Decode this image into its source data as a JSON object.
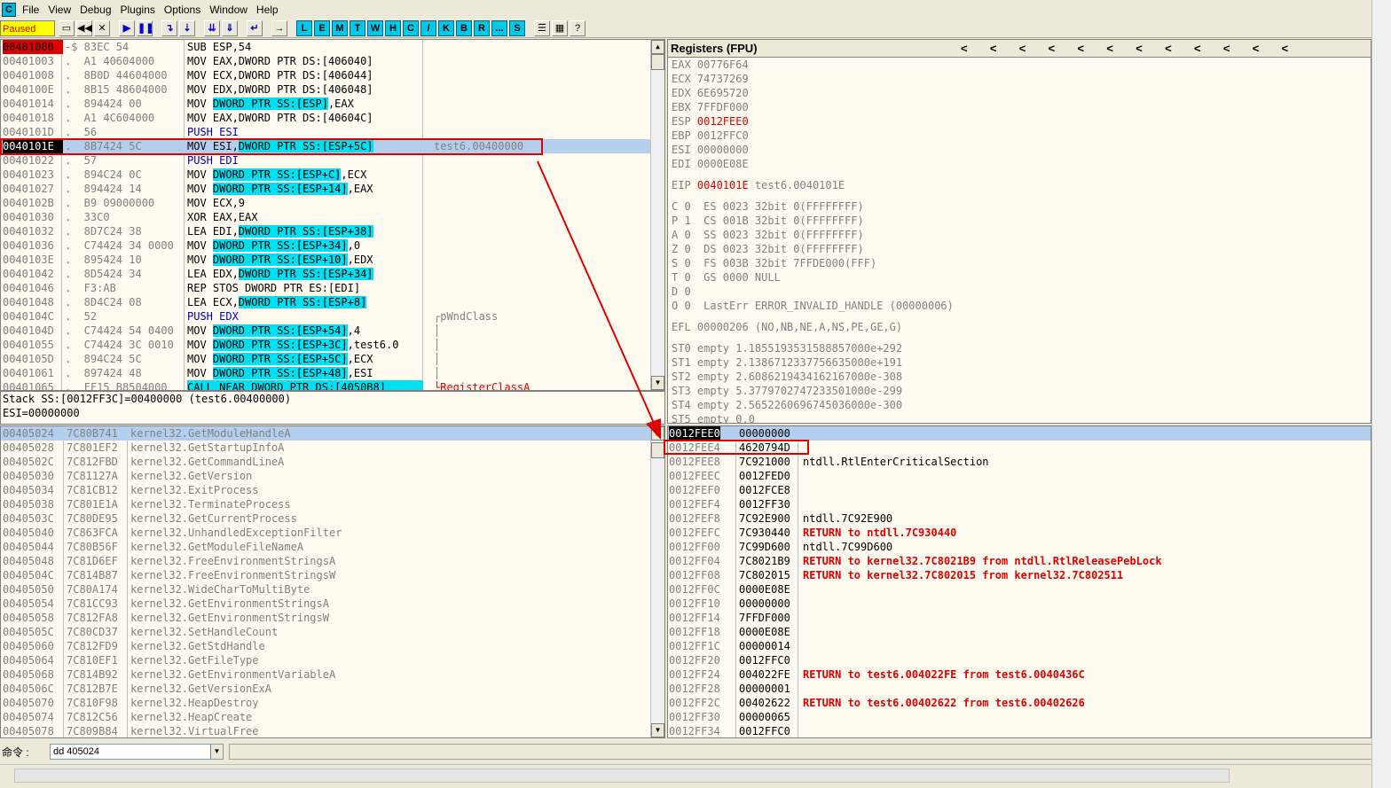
{
  "menu": [
    "File",
    "View",
    "Debug",
    "Plugins",
    "Options",
    "Window",
    "Help"
  ],
  "status": "Paused",
  "toolbar_letters": [
    "L",
    "E",
    "M",
    "T",
    "W",
    "H",
    "C",
    "/",
    "K",
    "B",
    "R",
    "...",
    "S"
  ],
  "cpu": [
    {
      "addr": "00401000",
      "mark": "-$",
      "hex": "83EC 54",
      "asm": "SUB ESP,54",
      "comment": ""
    },
    {
      "addr": "00401003",
      "mark": ".",
      "hex": "A1 40604000",
      "asm": "MOV EAX,DWORD PTR DS:[406040]",
      "comment": ""
    },
    {
      "addr": "00401008",
      "mark": ".",
      "hex": "8B0D 44604000",
      "asm": "MOV ECX,DWORD PTR DS:[406044]",
      "comment": ""
    },
    {
      "addr": "0040100E",
      "mark": ".",
      "hex": "8B15 48604000",
      "asm": "MOV EDX,DWORD PTR DS:[406048]",
      "comment": ""
    },
    {
      "addr": "00401014",
      "mark": ".",
      "hex": "894424 00",
      "asm": "MOV DWORD PTR SS:[ESP],EAX",
      "comment": ""
    },
    {
      "addr": "00401018",
      "mark": ".",
      "hex": "A1 4C604000",
      "asm": "MOV EAX,DWORD PTR DS:[40604C]",
      "comment": ""
    },
    {
      "addr": "0040101D",
      "mark": ".",
      "hex": "56",
      "asm": "PUSH ESI",
      "comment": ""
    },
    {
      "addr": "0040101E",
      "mark": ".",
      "hex": "8B7424 5C",
      "asm": "MOV ESI,DWORD PTR SS:[ESP+5C]",
      "comment": "test6.00400000"
    },
    {
      "addr": "00401022",
      "mark": ".",
      "hex": "57",
      "asm": "PUSH EDI",
      "comment": ""
    },
    {
      "addr": "00401023",
      "mark": ".",
      "hex": "894C24 0C",
      "asm": "MOV DWORD PTR SS:[ESP+C],ECX",
      "comment": ""
    },
    {
      "addr": "00401027",
      "mark": ".",
      "hex": "894424 14",
      "asm": "MOV DWORD PTR SS:[ESP+14],EAX",
      "comment": ""
    },
    {
      "addr": "0040102B",
      "mark": ".",
      "hex": "B9 09000000",
      "asm": "MOV ECX,9",
      "comment": ""
    },
    {
      "addr": "00401030",
      "mark": ".",
      "hex": "33C0",
      "asm": "XOR EAX,EAX",
      "comment": ""
    },
    {
      "addr": "00401032",
      "mark": ".",
      "hex": "8D7C24 38",
      "asm": "LEA EDI,DWORD PTR SS:[ESP+38]",
      "comment": ""
    },
    {
      "addr": "00401036",
      "mark": ".",
      "hex": "C74424 34 0000",
      "asm": "MOV DWORD PTR SS:[ESP+34],0",
      "comment": ""
    },
    {
      "addr": "0040103E",
      "mark": ".",
      "hex": "895424 10",
      "asm": "MOV DWORD PTR SS:[ESP+10],EDX",
      "comment": ""
    },
    {
      "addr": "00401042",
      "mark": ".",
      "hex": "8D5424 34",
      "asm": "LEA EDX,DWORD PTR SS:[ESP+34]",
      "comment": ""
    },
    {
      "addr": "00401046",
      "mark": ".",
      "hex": "F3:AB",
      "asm": "REP STOS DWORD PTR ES:[EDI]",
      "comment": ""
    },
    {
      "addr": "00401048",
      "mark": ".",
      "hex": "8D4C24 08",
      "asm": "LEA ECX,DWORD PTR SS:[ESP+8]",
      "comment": ""
    },
    {
      "addr": "0040104C",
      "mark": ".",
      "hex": "52",
      "asm": "PUSH EDX",
      "comment": "┌pWndClass"
    },
    {
      "addr": "0040104D",
      "mark": ".",
      "hex": "C74424 54 0400",
      "asm": "MOV DWORD PTR SS:[ESP+54],4",
      "comment": "│"
    },
    {
      "addr": "00401055",
      "mark": ".",
      "hex": "C74424 3C 0010",
      "asm": "MOV DWORD PTR SS:[ESP+3C],test6.0",
      "comment": "│"
    },
    {
      "addr": "0040105D",
      "mark": ".",
      "hex": "894C24 5C",
      "asm": "MOV DWORD PTR SS:[ESP+5C],ECX",
      "comment": "│"
    },
    {
      "addr": "00401061",
      "mark": ".",
      "hex": "897424 48",
      "asm": "MOV DWORD PTR SS:[ESP+48],ESI",
      "comment": "│"
    },
    {
      "addr": "00401065",
      "mark": ".",
      "hex": "FF15 B8504000",
      "asm": "CALL NEAR DWORD PTR DS:[4050B8]",
      "comment": "└RegisterClassA"
    }
  ],
  "info": [
    "Stack SS:[0012FF3C]=00400000 (test6.00400000)",
    "ESI=00000000"
  ],
  "registers_title": "Registers (FPU)",
  "regs": [
    {
      "name": "EAX",
      "val": "00776F64",
      "extra": ""
    },
    {
      "name": "ECX",
      "val": "74737269",
      "extra": ""
    },
    {
      "name": "EDX",
      "val": "6E695720",
      "extra": ""
    },
    {
      "name": "EBX",
      "val": "7FFDF000",
      "extra": ""
    },
    {
      "name": "ESP",
      "val": "0012FEE0",
      "extra": ""
    },
    {
      "name": "EBP",
      "val": "0012FFC0",
      "extra": ""
    },
    {
      "name": "ESI",
      "val": "00000000",
      "extra": ""
    },
    {
      "name": "EDI",
      "val": "0000E08E",
      "extra": ""
    }
  ],
  "eip": {
    "name": "EIP",
    "val": "0040101E",
    "extra": "test6.0040101E"
  },
  "flags": [
    "C 0  ES 0023 32bit 0(FFFFFFFF)",
    "P 1  CS 001B 32bit 0(FFFFFFFF)",
    "A 0  SS 0023 32bit 0(FFFFFFFF)",
    "Z 0  DS 0023 32bit 0(FFFFFFFF)",
    "S 0  FS 003B 32bit 7FFDE000(FFF)",
    "T 0  GS 0000 NULL",
    "D 0",
    "O 0  LastErr ERROR_INVALID_HANDLE (00000006)"
  ],
  "efl": "EFL 00000206 (NO,NB,NE,A,NS,PE,GE,G)",
  "fpu": [
    "ST0 empty 1.1855193531588857000e+292",
    "ST1 empty 2.1386712337756635000e+191",
    "ST2 empty 2.6086219434162167000e-308",
    "ST3 empty 5.3779702747233501000e-299",
    "ST4 empty 2.5652260696745036000e-300",
    "ST5 empty 0.0"
  ],
  "dump": [
    {
      "a": "00405024",
      "h": "7C80B741",
      "t": "kernel32.GetModuleHandleA"
    },
    {
      "a": "00405028",
      "h": "7C801EF2",
      "t": "kernel32.GetStartupInfoA"
    },
    {
      "a": "0040502C",
      "h": "7C812FBD",
      "t": "kernel32.GetCommandLineA"
    },
    {
      "a": "00405030",
      "h": "7C81127A",
      "t": "kernel32.GetVersion"
    },
    {
      "a": "00405034",
      "h": "7C81CB12",
      "t": "kernel32.ExitProcess"
    },
    {
      "a": "00405038",
      "h": "7C801E1A",
      "t": "kernel32.TerminateProcess"
    },
    {
      "a": "0040503C",
      "h": "7C80DE95",
      "t": "kernel32.GetCurrentProcess"
    },
    {
      "a": "00405040",
      "h": "7C863FCA",
      "t": "kernel32.UnhandledExceptionFilter"
    },
    {
      "a": "00405044",
      "h": "7C80B56F",
      "t": "kernel32.GetModuleFileNameA"
    },
    {
      "a": "00405048",
      "h": "7C81D6EF",
      "t": "kernel32.FreeEnvironmentStringsA"
    },
    {
      "a": "0040504C",
      "h": "7C814B87",
      "t": "kernel32.FreeEnvironmentStringsW"
    },
    {
      "a": "00405050",
      "h": "7C80A174",
      "t": "kernel32.WideCharToMultiByte"
    },
    {
      "a": "00405054",
      "h": "7C81CC93",
      "t": "kernel32.GetEnvironmentStringsA"
    },
    {
      "a": "00405058",
      "h": "7C812FA8",
      "t": "kernel32.GetEnvironmentStringsW"
    },
    {
      "a": "0040505C",
      "h": "7C80CD37",
      "t": "kernel32.SetHandleCount"
    },
    {
      "a": "00405060",
      "h": "7C812FD9",
      "t": "kernel32.GetStdHandle"
    },
    {
      "a": "00405064",
      "h": "7C810EF1",
      "t": "kernel32.GetFileType"
    },
    {
      "a": "00405068",
      "h": "7C814B92",
      "t": "kernel32.GetEnvironmentVariableA"
    },
    {
      "a": "0040506C",
      "h": "7C812B7E",
      "t": "kernel32.GetVersionExA"
    },
    {
      "a": "00405070",
      "h": "7C810F98",
      "t": "kernel32.HeapDestroy"
    },
    {
      "a": "00405074",
      "h": "7C812C56",
      "t": "kernel32.HeapCreate"
    },
    {
      "a": "00405078",
      "h": "7C809B84",
      "t": "kernel32.VirtualFree"
    }
  ],
  "stack": [
    {
      "a": "0012FEE0",
      "v": "00000000",
      "c": "",
      "red": false
    },
    {
      "a": "0012FEE4",
      "v": "4620794D",
      "c": "",
      "red": false
    },
    {
      "a": "0012FEE8",
      "v": "7C921000",
      "c": "ntdll.RtlEnterCriticalSection",
      "red": false
    },
    {
      "a": "0012FEEC",
      "v": "0012FED0",
      "c": "",
      "red": false
    },
    {
      "a": "0012FEF0",
      "v": "0012FCE8",
      "c": "",
      "red": false
    },
    {
      "a": "0012FEF4",
      "v": "0012FF30",
      "c": "",
      "red": false
    },
    {
      "a": "0012FEF8",
      "v": "7C92E900",
      "c": "ntdll.7C92E900",
      "red": false
    },
    {
      "a": "0012FEFC",
      "v": "7C930440",
      "c": "RETURN to ntdll.7C930440",
      "red": true
    },
    {
      "a": "0012FF00",
      "v": "7C99D600",
      "c": "ntdll.7C99D600",
      "red": false
    },
    {
      "a": "0012FF04",
      "v": "7C8021B9",
      "c": "RETURN to kernel32.7C8021B9 from ntdll.RtlReleasePebLock",
      "red": true
    },
    {
      "a": "0012FF08",
      "v": "7C802015",
      "c": "RETURN to kernel32.7C802015 from kernel32.7C802511",
      "red": true
    },
    {
      "a": "0012FF0C",
      "v": "0000E08E",
      "c": "",
      "red": false
    },
    {
      "a": "0012FF10",
      "v": "00000000",
      "c": "",
      "red": false
    },
    {
      "a": "0012FF14",
      "v": "7FFDF000",
      "c": "",
      "red": false
    },
    {
      "a": "0012FF18",
      "v": "0000E08E",
      "c": "",
      "red": false
    },
    {
      "a": "0012FF1C",
      "v": "00000014",
      "c": "",
      "red": false
    },
    {
      "a": "0012FF20",
      "v": "0012FFC0",
      "c": "",
      "red": false
    },
    {
      "a": "0012FF24",
      "v": "004022FE",
      "c": "RETURN to test6.004022FE from test6.0040436C",
      "red": true
    },
    {
      "a": "0012FF28",
      "v": "00000001",
      "c": "",
      "red": false
    },
    {
      "a": "0012FF2C",
      "v": "00402622",
      "c": "RETURN to test6.00402622 from test6.00402626",
      "red": true
    },
    {
      "a": "0012FF30",
      "v": "00000065",
      "c": "",
      "red": false
    },
    {
      "a": "0012FF34",
      "v": "0012FFC0",
      "c": "",
      "red": false
    }
  ],
  "command": {
    "label": "命令 :",
    "value": "dd 405024"
  },
  "colors": {
    "highlight": "#00e0f0",
    "selection": "#b4cfee",
    "annotation": "#e00000",
    "status_bg": "#ffff00"
  }
}
